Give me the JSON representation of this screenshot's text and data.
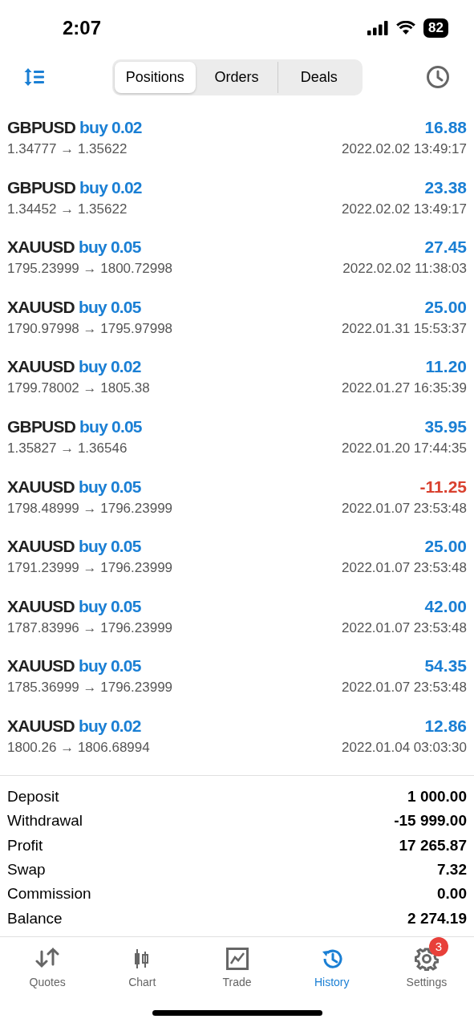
{
  "status_bar": {
    "time": "2:07",
    "battery": "82"
  },
  "segments": [
    {
      "label": "Positions",
      "selected": true
    },
    {
      "label": "Orders",
      "selected": false
    },
    {
      "label": "Deals",
      "selected": false
    }
  ],
  "deals": [
    {
      "symbol": "GBPUSD",
      "side": "buy",
      "volume": "0.02",
      "prices": "1.34777 → 1.35622",
      "profit": "16.88",
      "negative": false,
      "time": "2022.02.02 13:49:17"
    },
    {
      "symbol": "GBPUSD",
      "side": "buy",
      "volume": "0.02",
      "prices": "1.34452 → 1.35622",
      "profit": "23.38",
      "negative": false,
      "time": "2022.02.02 13:49:17"
    },
    {
      "symbol": "XAUUSD",
      "side": "buy",
      "volume": "0.05",
      "prices": "1795.23999 → 1800.72998",
      "profit": "27.45",
      "negative": false,
      "time": "2022.02.02 11:38:03"
    },
    {
      "symbol": "XAUUSD",
      "side": "buy",
      "volume": "0.05",
      "prices": "1790.97998 → 1795.97998",
      "profit": "25.00",
      "negative": false,
      "time": "2022.01.31 15:53:37"
    },
    {
      "symbol": "XAUUSD",
      "side": "buy",
      "volume": "0.02",
      "prices": "1799.78002 → 1805.38",
      "profit": "11.20",
      "negative": false,
      "time": "2022.01.27 16:35:39"
    },
    {
      "symbol": "GBPUSD",
      "side": "buy",
      "volume": "0.05",
      "prices": "1.35827 → 1.36546",
      "profit": "35.95",
      "negative": false,
      "time": "2022.01.20 17:44:35"
    },
    {
      "symbol": "XAUUSD",
      "side": "buy",
      "volume": "0.05",
      "prices": "1798.48999 → 1796.23999",
      "profit": "-11.25",
      "negative": true,
      "time": "2022.01.07 23:53:48"
    },
    {
      "symbol": "XAUUSD",
      "side": "buy",
      "volume": "0.05",
      "prices": "1791.23999 → 1796.23999",
      "profit": "25.00",
      "negative": false,
      "time": "2022.01.07 23:53:48"
    },
    {
      "symbol": "XAUUSD",
      "side": "buy",
      "volume": "0.05",
      "prices": "1787.83996 → 1796.23999",
      "profit": "42.00",
      "negative": false,
      "time": "2022.01.07 23:53:48"
    },
    {
      "symbol": "XAUUSD",
      "side": "buy",
      "volume": "0.05",
      "prices": "1785.36999 → 1796.23999",
      "profit": "54.35",
      "negative": false,
      "time": "2022.01.07 23:53:48"
    },
    {
      "symbol": "XAUUSD",
      "side": "buy",
      "volume": "0.02",
      "prices": "1800.26 → 1806.68994",
      "profit": "12.86",
      "negative": false,
      "time": "2022.01.04 03:03:30"
    }
  ],
  "summary": [
    {
      "label": "Deposit",
      "value": "1 000.00"
    },
    {
      "label": "Withdrawal",
      "value": "-15 999.00"
    },
    {
      "label": "Profit",
      "value": "17 265.87"
    },
    {
      "label": "Swap",
      "value": "7.32"
    },
    {
      "label": "Commission",
      "value": "0.00"
    },
    {
      "label": "Balance",
      "value": "2 274.19"
    }
  ],
  "tab_bar": [
    {
      "kind": "quotes",
      "label": "Quotes",
      "selected": false
    },
    {
      "kind": "chart",
      "label": "Chart",
      "selected": false
    },
    {
      "kind": "trade",
      "label": "Trade",
      "selected": false
    },
    {
      "kind": "history",
      "label": "History",
      "selected": true
    },
    {
      "kind": "settings",
      "label": "Settings",
      "selected": false,
      "badge": "3"
    }
  ]
}
